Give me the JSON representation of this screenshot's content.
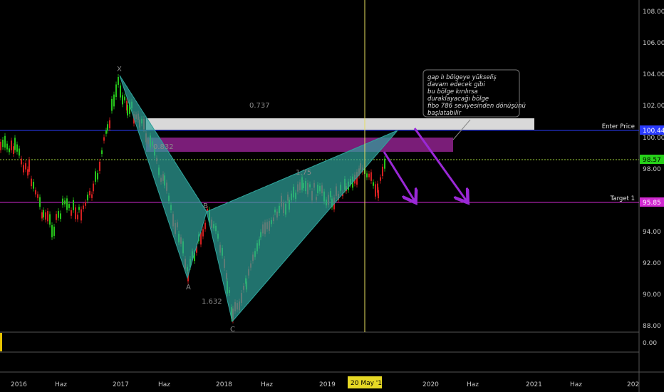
{
  "colors": {
    "background": "#000000",
    "candle_up": "#26c61a",
    "candle_down": "#d32020",
    "pattern_fill": "#2fa39b",
    "enter_line": "#2a3bff",
    "target_line": "#d12ad1",
    "current_line": "#a3d93a",
    "gap_zone": "#d9d9d9",
    "entry_zone": "#7a1d78",
    "arrow": "#9a28d6",
    "vertical_line": "#e8e060"
  },
  "price_axis": {
    "ticks": [
      "108.00",
      "106.00",
      "104.00",
      "102.00",
      "100.00",
      "98.00",
      "94.00",
      "92.00",
      "90.00",
      "88.00"
    ],
    "sub_ticks": [
      "0.00"
    ]
  },
  "time_axis": {
    "ticks": [
      "2016",
      "Haz",
      "2017",
      "Haz",
      "2018",
      "Haz",
      "2019",
      "2020",
      "Haz",
      "2021",
      "Haz",
      "202"
    ],
    "cursor_label": "20 May '19"
  },
  "price_labels": {
    "enter": {
      "name": "Enter Price",
      "value": "100.44"
    },
    "current": {
      "value": "98.57"
    },
    "target": {
      "name": "Target 1",
      "value": "95.85"
    }
  },
  "pattern": {
    "points": {
      "x": "X",
      "a": "A",
      "b": "B",
      "c": "C"
    },
    "ratios": {
      "xb": "0.832",
      "ac": "1.632",
      "bd": "1.75",
      "xd": "0.737"
    }
  },
  "annotation": {
    "lines": [
      "gap lı bölgeye yükseliş",
      "davam edecek gibi",
      "bu bölge kırılırsa",
      "duraklayacağı bölge",
      "fibo 786 seviyesinden dönüşünü",
      "başlatabilir"
    ]
  }
}
